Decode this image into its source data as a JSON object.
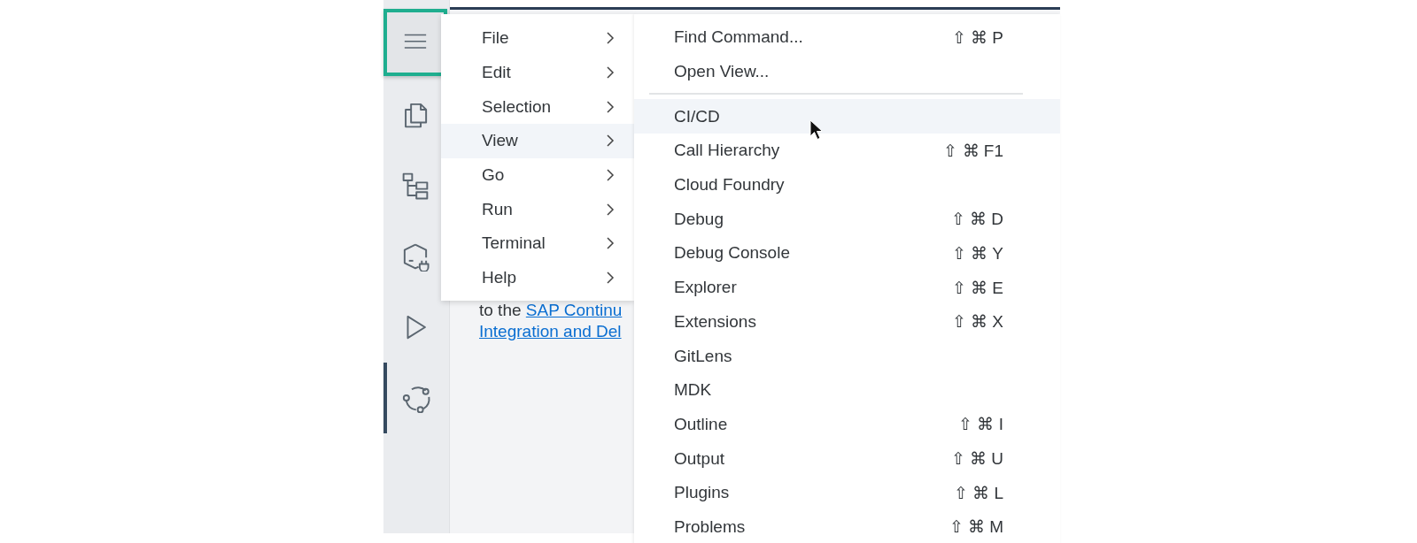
{
  "activity_bar": {
    "items": [
      {
        "kind": "menu",
        "selected": false,
        "highlighted": true
      },
      {
        "kind": "copy",
        "selected": false,
        "highlighted": false
      },
      {
        "kind": "tree",
        "selected": false,
        "highlighted": false
      },
      {
        "kind": "cube-plug",
        "selected": false,
        "highlighted": false
      },
      {
        "kind": "play",
        "selected": false,
        "highlighted": false
      },
      {
        "kind": "cycle",
        "selected": true,
        "highlighted": false
      }
    ]
  },
  "content": {
    "text": "to the ",
    "link_parts": [
      "SAP Continu",
      "Integration and Del"
    ]
  },
  "menu": {
    "items": [
      {
        "label": "File",
        "selected": false
      },
      {
        "label": "Edit",
        "selected": false
      },
      {
        "label": "Selection",
        "selected": false
      },
      {
        "label": "View",
        "selected": true
      },
      {
        "label": "Go",
        "selected": false
      },
      {
        "label": "Run",
        "selected": false
      },
      {
        "label": "Terminal",
        "selected": false
      },
      {
        "label": "Help",
        "selected": false
      }
    ]
  },
  "submenu": {
    "items": [
      {
        "kind": "item",
        "label": "Find Command...",
        "shortcut": "⇧ ⌘ P",
        "selected": false
      },
      {
        "kind": "item",
        "label": "Open View...",
        "selected": false
      },
      {
        "kind": "separator"
      },
      {
        "kind": "item",
        "label": "CI/CD",
        "selected": true
      },
      {
        "kind": "item",
        "label": "Call Hierarchy",
        "shortcut": "⇧ ⌘ F1",
        "selected": false
      },
      {
        "kind": "item",
        "label": "Cloud Foundry",
        "selected": false
      },
      {
        "kind": "item",
        "label": "Debug",
        "shortcut": "⇧ ⌘ D",
        "selected": false
      },
      {
        "kind": "item",
        "label": "Debug Console",
        "shortcut": "⇧ ⌘ Y",
        "selected": false
      },
      {
        "kind": "item",
        "label": "Explorer",
        "shortcut": "⇧ ⌘ E",
        "selected": false
      },
      {
        "kind": "item",
        "label": "Extensions",
        "shortcut": "⇧ ⌘ X",
        "selected": false
      },
      {
        "kind": "item",
        "label": "GitLens",
        "selected": false
      },
      {
        "kind": "item",
        "label": "MDK",
        "selected": false
      },
      {
        "kind": "item",
        "label": "Outline",
        "shortcut": "⇧ ⌘ I",
        "selected": false
      },
      {
        "kind": "item",
        "label": "Output",
        "shortcut": "⇧ ⌘ U",
        "selected": false
      },
      {
        "kind": "item",
        "label": "Plugins",
        "shortcut": "⇧ ⌘ L",
        "selected": false
      },
      {
        "kind": "item",
        "label": "Problems",
        "shortcut": "⇧ ⌘ M",
        "selected": false
      }
    ]
  }
}
